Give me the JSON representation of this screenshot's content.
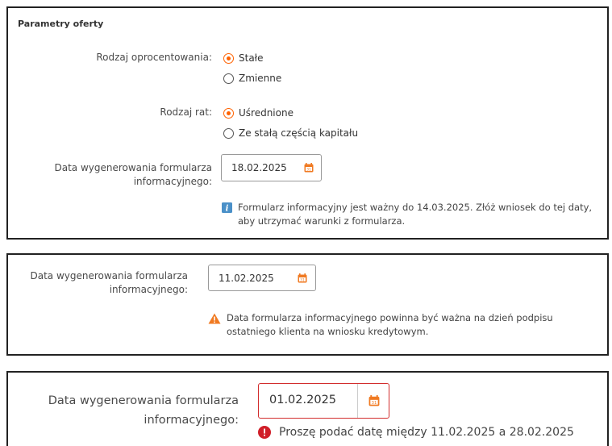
{
  "panel1": {
    "title": "Parametry oferty",
    "interest_label": "Rodzaj oprocentowania:",
    "interest_options": [
      {
        "label": "Stałe",
        "selected": true
      },
      {
        "label": "Zmienne",
        "selected": false
      }
    ],
    "installment_label": "Rodzaj rat:",
    "installment_options": [
      {
        "label": "Uśrednione",
        "selected": true
      },
      {
        "label": "Ze stałą częścią kapitału",
        "selected": false
      }
    ],
    "date_label_line1": "Data wygenerowania formularza",
    "date_label_line2": "informacyjnego:",
    "date_value": "18.02.2025",
    "info_line1": "Formularz informacyjny jest ważny do 14.03.2025. Złóż wniosek do tej daty,",
    "info_line2": "aby utrzymać warunki z formularza."
  },
  "panel2": {
    "date_label_line1": "Data wygenerowania formularza",
    "date_label_line2": "informacyjnego:",
    "date_value": "11.02.2025",
    "warning_line1": "Data formularza informacyjnego powinna być ważna na dzień podpisu",
    "warning_line2": "ostatniego klienta na wniosku kredytowym."
  },
  "panel3": {
    "date_label_line1": "Data wygenerowania formularza",
    "date_label_line2": "informacyjnego:",
    "date_value": "01.02.2025",
    "error_text": "Proszę podać datę między 11.02.2025 a 28.02.2025"
  },
  "colors": {
    "accent": "#ff6200",
    "info": "#4a90c8",
    "warning": "#f07a22",
    "error": "#d01e28",
    "error_border": "#d22d2d"
  },
  "icons": {
    "calendar": "calendar-icon",
    "info": "info-icon",
    "warning": "warning-icon",
    "error": "error-icon"
  }
}
